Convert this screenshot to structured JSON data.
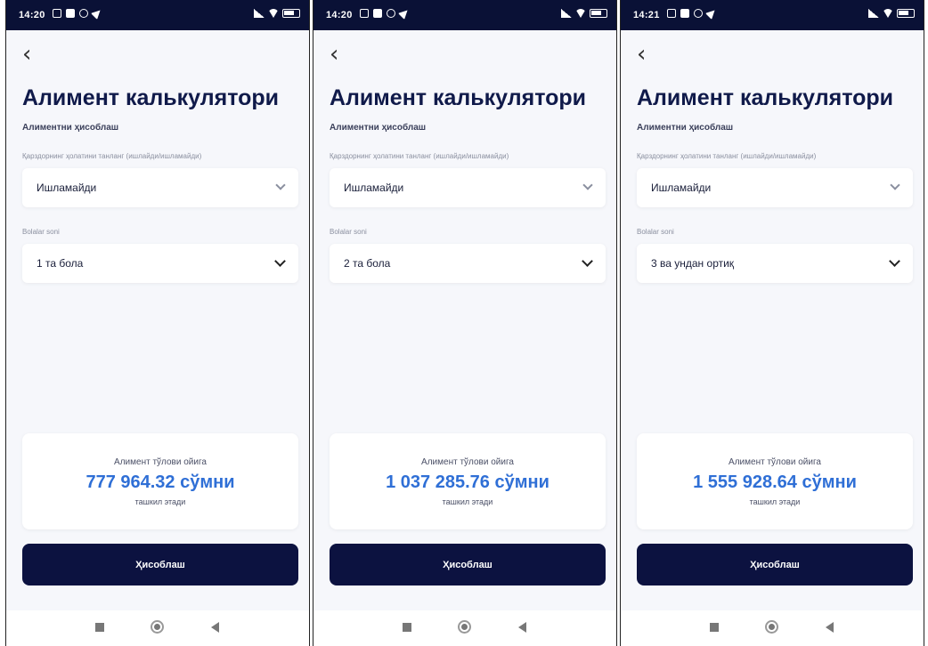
{
  "screens": [
    {
      "status_time": "14:20",
      "title": "Алимент калькулятори",
      "subtitle": "Алиментни ҳисоблаш",
      "status_label": "Қарздорнинг ҳолатини танланг (ишлайди/ишламайди)",
      "status_value": "Ишламайди",
      "children_label": "Bolalar soni",
      "children_value": "1 та бола",
      "result_caption": "Алимент тўлови ойига",
      "result_amount": "777 964.32 сўмни",
      "result_after": "ташкил этади",
      "calculate_label": "Ҳисоблаш"
    },
    {
      "status_time": "14:20",
      "title": "Алимент калькулятори",
      "subtitle": "Алиментни ҳисоблаш",
      "status_label": "Қарздорнинг ҳолатини танланг (ишлайди/ишламайди)",
      "status_value": "Ишламайди",
      "children_label": "Bolalar soni",
      "children_value": "2 та бола",
      "result_caption": "Алимент тўлови ойига",
      "result_amount": "1 037 285.76 сўмни",
      "result_after": "ташкил этади",
      "calculate_label": "Ҳисоблаш"
    },
    {
      "status_time": "14:21",
      "title": "Алимент калькулятори",
      "subtitle": "Алиментни ҳисоблаш",
      "status_label": "Қарздорнинг ҳолатини танланг (ишлайди/ишламайди)",
      "status_value": "Ишламайди",
      "children_label": "Bolalar soni",
      "children_value": "3 ва ундан ортиқ",
      "result_caption": "Алимент тўлови ойига",
      "result_amount": "1 555 928.64 сўмни",
      "result_after": "ташкил этади",
      "calculate_label": "Ҳисоблаш"
    }
  ],
  "colors": {
    "status_bar": "#0a1136",
    "title": "#101a4a",
    "amount": "#2f6fd6",
    "button": "#0c1240",
    "background": "#f6f7fb"
  }
}
